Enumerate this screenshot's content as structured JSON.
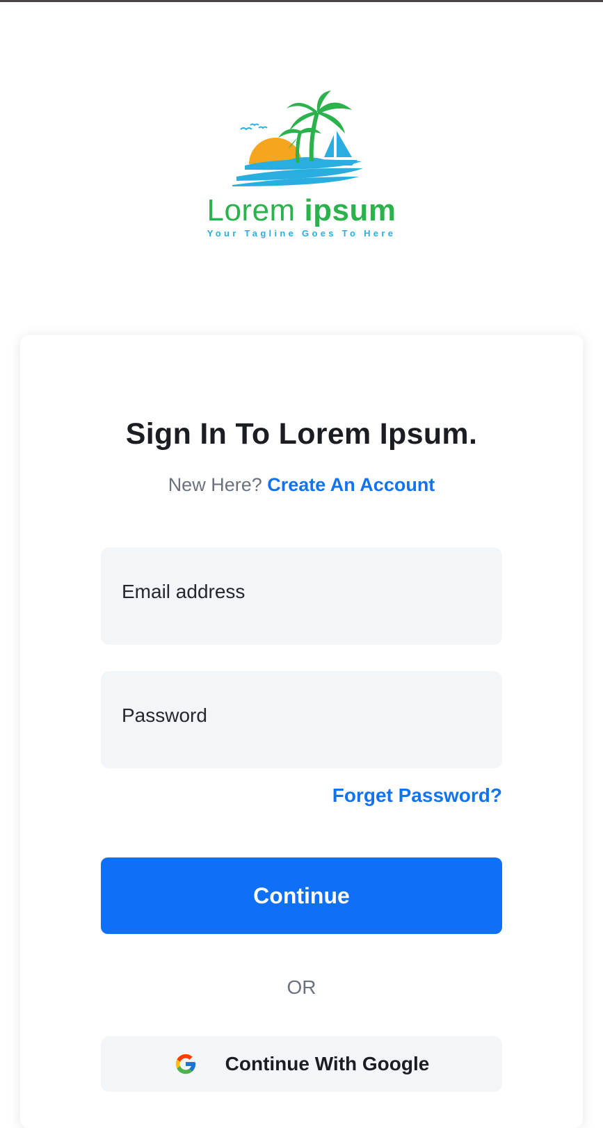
{
  "brand": {
    "name_regular": "Lorem ",
    "name_bold": "ipsum",
    "tagline": "Your Tagline Goes To Here"
  },
  "signin": {
    "title": "Sign In To Lorem Ipsum.",
    "new_here": "New Here?",
    "create_account": "Create An Account",
    "email_placeholder": "Email address",
    "password_placeholder": "Password",
    "forgot_password": "Forget Password?",
    "continue_label": "Continue",
    "or_label": "OR",
    "google_label": "Continue With Google"
  },
  "colors": {
    "accent_blue": "#1273f0",
    "button_blue": "#106ff7",
    "brand_green": "#2bb24c",
    "tagline_blue": "#2aaee0",
    "field_bg": "#f3f6f9"
  },
  "icons": {
    "logo": "tropical-island-logo",
    "google": "google-g-icon"
  }
}
